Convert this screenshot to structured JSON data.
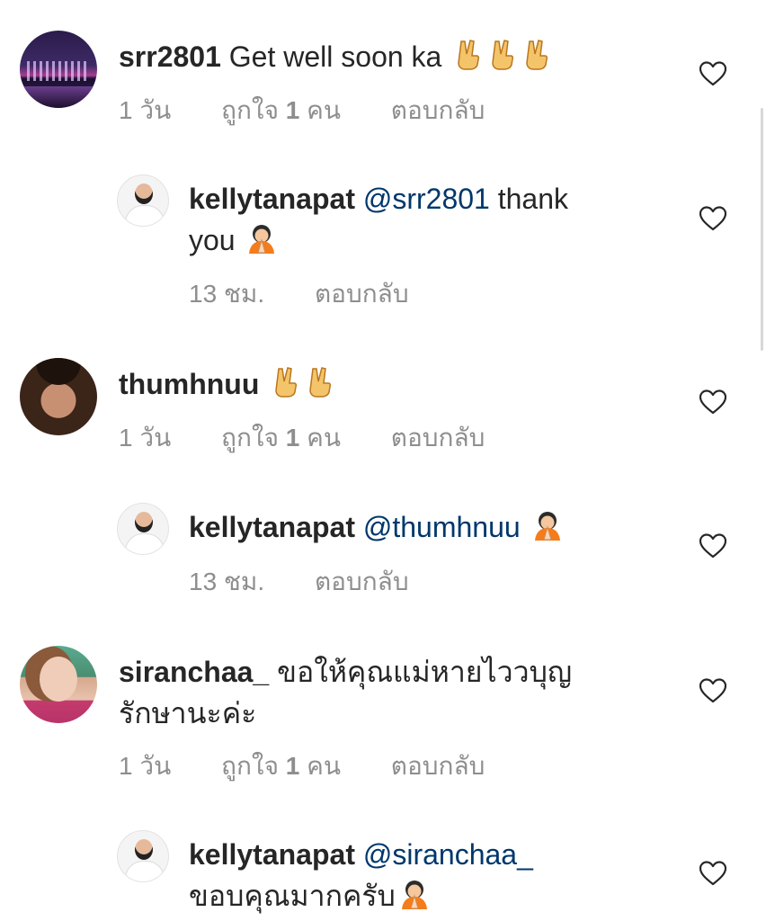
{
  "comments": [
    {
      "username": "srr2801",
      "text": "Get well soon ka",
      "emoji": [
        "victory-hand",
        "victory-hand",
        "victory-hand"
      ],
      "time": "1 วัน",
      "likes_prefix": "ถูกใจ",
      "likes_count": "1",
      "likes_suffix": "คน",
      "reply_label": "ตอบกลับ"
    },
    {
      "username": "kellytanapat",
      "mention": "@srr2801",
      "text_line1": "thank",
      "text_line2": "you",
      "emoji": [
        "pray"
      ],
      "time": "13 ชม.",
      "reply_label": "ตอบกลับ"
    },
    {
      "username": "thumhnuu",
      "emoji": [
        "victory-hand",
        "victory-hand"
      ],
      "time": "1 วัน",
      "likes_prefix": "ถูกใจ",
      "likes_count": "1",
      "likes_suffix": "คน",
      "reply_label": "ตอบกลับ"
    },
    {
      "username": "kellytanapat",
      "mention": "@thumhnuu",
      "emoji": [
        "pray"
      ],
      "time": "13 ชม.",
      "reply_label": "ตอบกลับ"
    },
    {
      "username": "siranchaa_",
      "text_line1": "ขอให้คุณแม่หายไววบุญ",
      "text_line2": "รักษานะค่ะ",
      "time": "1 วัน",
      "likes_prefix": "ถูกใจ",
      "likes_count": "1",
      "likes_suffix": "คน",
      "reply_label": "ตอบกลับ"
    },
    {
      "username": "kellytanapat",
      "mention": "@siranchaa_",
      "text_line2": "ขอบคุณมากครับ",
      "emoji": [
        "pray"
      ]
    }
  ],
  "colors": {
    "text": "#262626",
    "meta": "#8e8e8e",
    "mention": "#00376b",
    "heart_stroke": "#262626"
  },
  "icons": [
    "heart-icon",
    "victory-hand-emoji",
    "pray-emoji"
  ]
}
